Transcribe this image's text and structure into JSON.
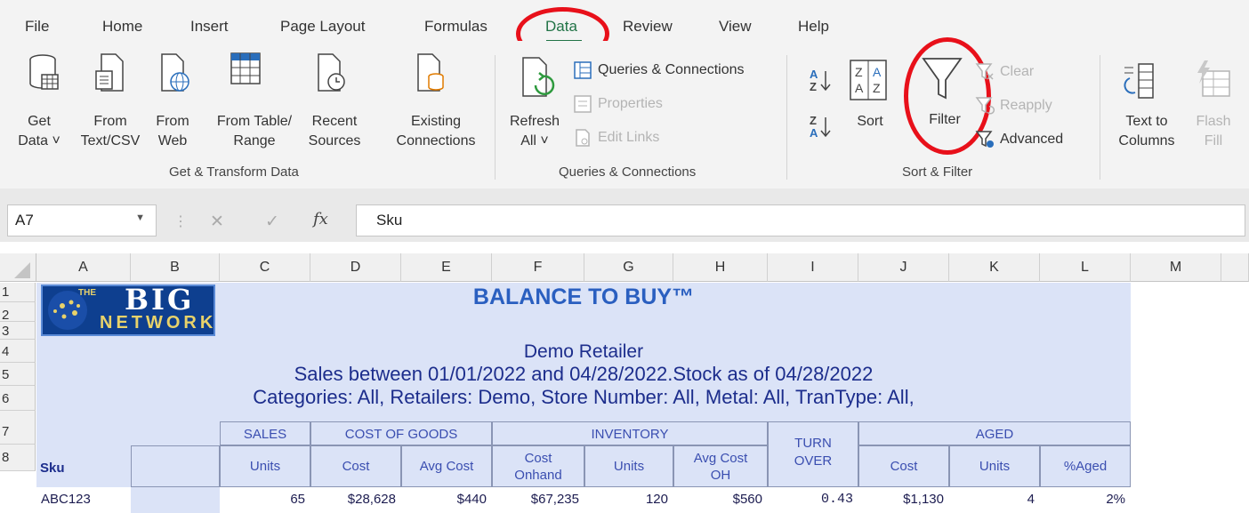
{
  "menu": {
    "items": [
      "File",
      "Home",
      "Insert",
      "Page Layout",
      "Formulas",
      "Data",
      "Review",
      "View",
      "Help"
    ],
    "active": "Data"
  },
  "ribbon": {
    "get_transform": {
      "get_data": [
        "Get",
        "Data ˅"
      ],
      "from_text": [
        "From",
        "Text/CSV"
      ],
      "from_web": [
        "From",
        "Web"
      ],
      "from_table": [
        "From Table/",
        "Range"
      ],
      "recent": [
        "Recent",
        "Sources"
      ],
      "existing": [
        "Existing",
        "Connections"
      ],
      "label": "Get & Transform Data"
    },
    "queries": {
      "refresh": [
        "Refresh",
        "All ˅"
      ],
      "queries_connections": "Queries & Connections",
      "properties": "Properties",
      "edit_links": "Edit Links",
      "label": "Queries & Connections"
    },
    "sort_filter": {
      "sort": "Sort",
      "filter": "Filter",
      "clear": "Clear",
      "reapply": "Reapply",
      "advanced": "Advanced",
      "label": "Sort & Filter"
    },
    "data_tools": {
      "text_to_columns": [
        "Text to",
        "Columns"
      ],
      "flash_fill": [
        "Flash",
        "Fill"
      ]
    }
  },
  "formula_bar": {
    "name_box": "A7",
    "fx": "fx",
    "content": "Sku"
  },
  "columns": [
    "A",
    "B",
    "C",
    "D",
    "E",
    "F",
    "G",
    "H",
    "I",
    "J",
    "K",
    "L",
    "M"
  ],
  "rows": [
    "1",
    "2",
    "3",
    "4",
    "5",
    "6",
    "7",
    "8"
  ],
  "sheet": {
    "logo": {
      "top": "BIG",
      "bottom": "NETWORK",
      "the": "THE"
    },
    "brand": "BALANCE TO BUY™",
    "retailer": "Demo Retailer",
    "sales_range": "Sales between 01/01/2022 and 04/28/2022.Stock as of 04/28/2022",
    "filters": "Categories: All, Retailers: Demo, Store Number: All, Metal: All, TranType: All,",
    "groups": {
      "sales": "SALES",
      "cogs": "COST OF GOODS",
      "inventory": "INVENTORY",
      "turn": "TURN OVER",
      "aged": "AGED"
    },
    "headers": {
      "sku": "Sku",
      "units": "Units",
      "cost": "Cost",
      "avg_cost": "Avg Cost",
      "cost_onhand": "Cost Onhand",
      "inv_units": "Units",
      "avg_cost_oh": "Avg Cost OH",
      "aged_cost": "Cost",
      "aged_units": "Units",
      "pct_aged": "%Aged"
    },
    "row8": {
      "sku": "ABC123",
      "units": "65",
      "cost": "$28,628",
      "avg_cost": "$440",
      "cost_onhand": "$67,235",
      "inv_units": "120",
      "avg_cost_oh": "$560",
      "turn": "0.43",
      "aged_cost": "$1,130",
      "aged_units": "4",
      "pct_aged": "2%"
    }
  },
  "colors": {
    "accent": "#217346",
    "annotation": "#e8101a",
    "sheet_fill": "#dbe3f7",
    "header_text": "#3a4eb0"
  }
}
